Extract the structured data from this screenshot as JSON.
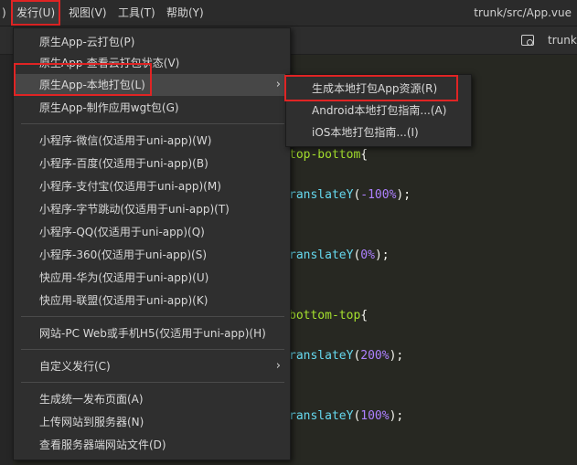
{
  "menubar": {
    "prefix": ")",
    "items": [
      "发行(U)",
      "视图(V)",
      "工具(T)",
      "帮助(Y)"
    ],
    "path": "trunk/src/App.vue"
  },
  "toolbar": {
    "tab_text": "trunk"
  },
  "code": [
    {
      "parts": [
        {
          "t": "top-bottom",
          "c": "sel"
        },
        {
          "t": "{",
          "c": "plain"
        }
      ]
    },
    {
      "parts": [
        {
          "t": "ranslateY",
          "c": "fn"
        },
        {
          "t": "(",
          "c": "plain"
        },
        {
          "t": "-100%",
          "c": "num"
        },
        {
          "t": ");",
          "c": "plain"
        }
      ]
    },
    {
      "parts": [
        {
          "t": "ranslateY",
          "c": "fn"
        },
        {
          "t": "(",
          "c": "plain"
        },
        {
          "t": "0%",
          "c": "num"
        },
        {
          "t": ");",
          "c": "plain"
        }
      ]
    },
    {
      "parts": [
        {
          "t": "bottom-top",
          "c": "sel"
        },
        {
          "t": "{",
          "c": "plain"
        }
      ]
    },
    {
      "parts": [
        {
          "t": "ranslateY",
          "c": "fn"
        },
        {
          "t": "(",
          "c": "plain"
        },
        {
          "t": "200%",
          "c": "num"
        },
        {
          "t": ");",
          "c": "plain"
        }
      ]
    },
    {
      "parts": [
        {
          "t": "ranslateY",
          "c": "fn"
        },
        {
          "t": "(",
          "c": "plain"
        },
        {
          "t": "100%",
          "c": "num"
        },
        {
          "t": ");",
          "c": "plain"
        }
      ]
    }
  ],
  "menu": {
    "items": [
      {
        "label": "原生App-云打包(P)"
      },
      {
        "label": "原生App-查看云打包状态(V)"
      },
      {
        "label": "原生App-本地打包(L)",
        "submenu": true
      },
      {
        "label": "原生App-制作应用wgt包(G)"
      },
      {
        "label": "小程序-微信(仅适用于uni-app)(W)"
      },
      {
        "label": "小程序-百度(仅适用于uni-app)(B)"
      },
      {
        "label": "小程序-支付宝(仅适用于uni-app)(M)"
      },
      {
        "label": "小程序-字节跳动(仅适用于uni-app)(T)"
      },
      {
        "label": "小程序-QQ(仅适用于uni-app)(Q)"
      },
      {
        "label": "小程序-360(仅适用于uni-app)(S)"
      },
      {
        "label": "快应用-华为(仅适用于uni-app)(U)"
      },
      {
        "label": "快应用-联盟(仅适用于uni-app)(K)"
      },
      {
        "label": "网站-PC Web或手机H5(仅适用于uni-app)(H)"
      },
      {
        "label": "自定义发行(C)",
        "submenu": true
      },
      {
        "label": "生成统一发布页面(A)"
      },
      {
        "label": "上传网站到服务器(N)"
      },
      {
        "label": "查看服务器端网站文件(D)"
      }
    ]
  },
  "submenu": {
    "items": [
      {
        "label": "生成本地打包App资源(R)"
      },
      {
        "label": "Android本地打包指南...(A)"
      },
      {
        "label": "iOS本地打包指南...(I)"
      }
    ]
  },
  "colors": {
    "highlight_border": "#e02424",
    "background": "#272822"
  }
}
